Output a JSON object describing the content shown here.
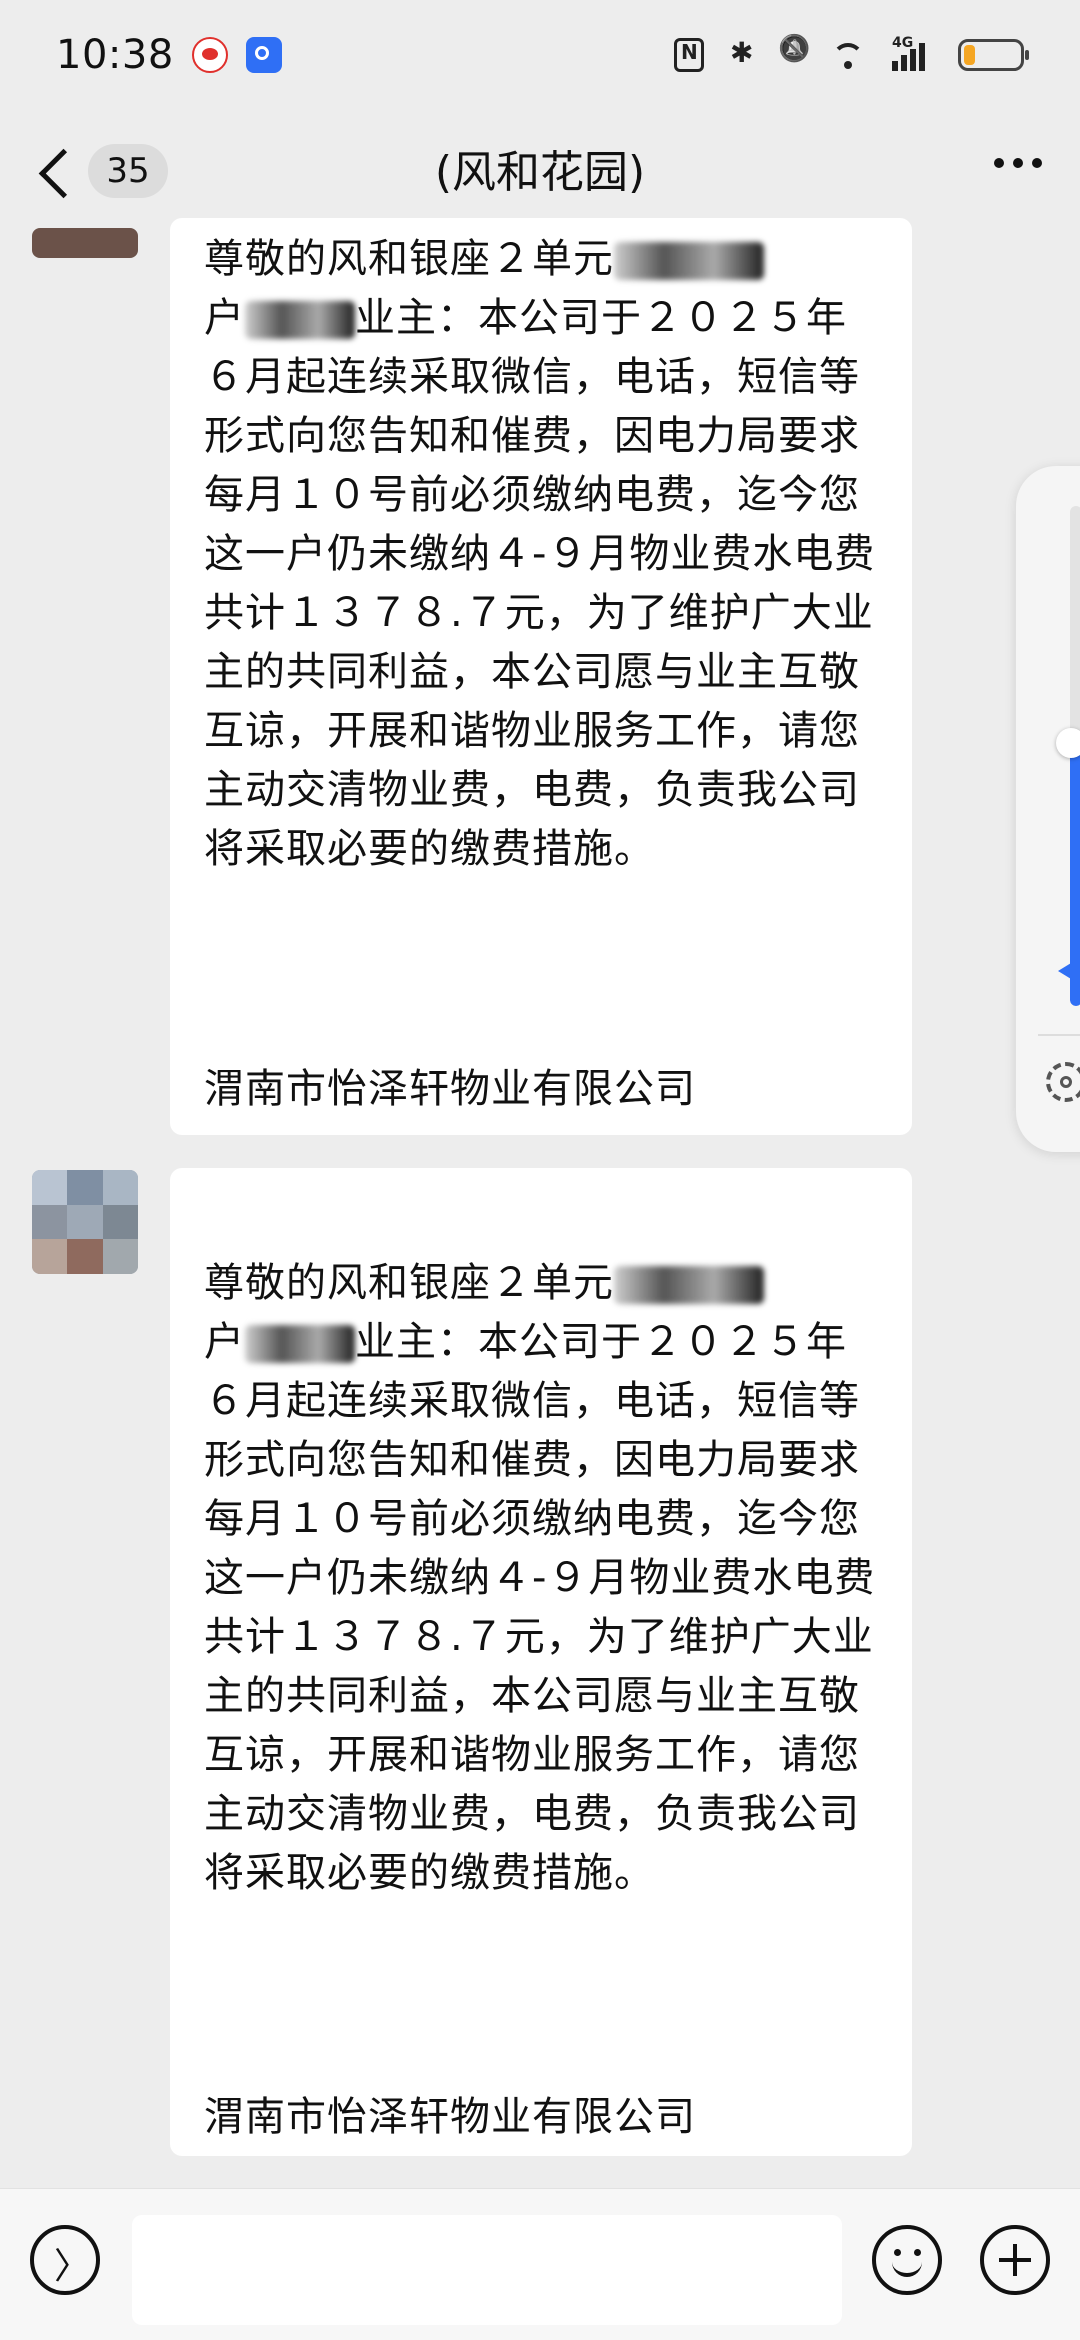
{
  "status_bar": {
    "time": "10:38",
    "network_label": "4G",
    "battery_level_percent": 20,
    "icons": [
      "weibo-icon",
      "app-icon",
      "nfc-icon",
      "bluetooth-icon",
      "mute-icon",
      "wifi-icon",
      "signal-icon",
      "battery-icon"
    ],
    "battery_color": "#f5a623"
  },
  "nav": {
    "unread_count": "35",
    "title": "(风和花园)",
    "icons": [
      "back-icon",
      "more-icon"
    ]
  },
  "messages": [
    {
      "text_line1": "尊敬的风和银座２单元",
      "text_line2_a": "户",
      "text_line2_b": "业主：本公司于２０２５年",
      "text_rest": "６月起连续采取微信，电话，短信等形式向您告知和催费，因电力局要求每月１０号前必须缴纳电费，迄今您这一户仍未缴纳４-９月物业费水电费共计１３７８.７元，为了维护广大业主的共同利益，本公司愿与业主互敬互谅，开展和谐物业服务工作，请您主动交清物业费，电费，负责我公司将采取必要的缴费措施。",
      "signature": "渭南市怡泽轩物业有限公司"
    },
    {
      "text_line1": "尊敬的风和银座２单元",
      "text_line2_a": "户",
      "text_line2_b": "业主：本公司于２０２５年",
      "text_rest": "６月起连续采取微信，电话，短信等形式向您告知和催费，因电力局要求每月１０号前必须缴纳电费，迄今您这一户仍未缴纳４-９月物业费水电费共计１３７８.７元，为了维护广大业主的共同利益，本公司愿与业主互敬互谅，开展和谐物业服务工作，请您主动交清物业费，电费，负责我公司将采取必要的缴费措施。",
      "signature": "渭南市怡泽轩物业有限公司"
    }
  ],
  "side_panel": {
    "volume_level_percent": 55,
    "accent_color": "#2f6ff5",
    "icons": [
      "volume-icon",
      "settings-icon"
    ]
  },
  "input_bar": {
    "placeholder": "",
    "icons": [
      "voice-icon",
      "emoji-icon",
      "plus-icon"
    ]
  }
}
